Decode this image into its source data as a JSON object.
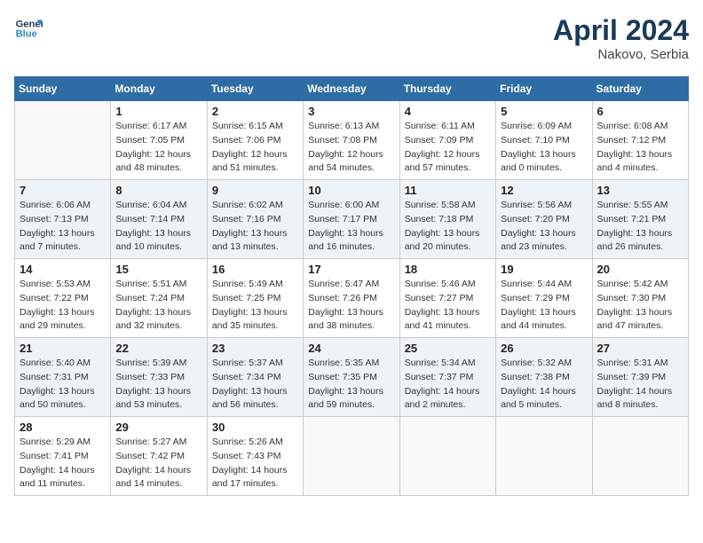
{
  "header": {
    "logo_line1": "General",
    "logo_line2": "Blue",
    "month_year": "April 2024",
    "location": "Nakovo, Serbia"
  },
  "columns": [
    "Sunday",
    "Monday",
    "Tuesday",
    "Wednesday",
    "Thursday",
    "Friday",
    "Saturday"
  ],
  "weeks": [
    [
      {
        "day": "",
        "info": ""
      },
      {
        "day": "1",
        "info": "Sunrise: 6:17 AM\nSunset: 7:05 PM\nDaylight: 12 hours\nand 48 minutes."
      },
      {
        "day": "2",
        "info": "Sunrise: 6:15 AM\nSunset: 7:06 PM\nDaylight: 12 hours\nand 51 minutes."
      },
      {
        "day": "3",
        "info": "Sunrise: 6:13 AM\nSunset: 7:08 PM\nDaylight: 12 hours\nand 54 minutes."
      },
      {
        "day": "4",
        "info": "Sunrise: 6:11 AM\nSunset: 7:09 PM\nDaylight: 12 hours\nand 57 minutes."
      },
      {
        "day": "5",
        "info": "Sunrise: 6:09 AM\nSunset: 7:10 PM\nDaylight: 13 hours\nand 0 minutes."
      },
      {
        "day": "6",
        "info": "Sunrise: 6:08 AM\nSunset: 7:12 PM\nDaylight: 13 hours\nand 4 minutes."
      }
    ],
    [
      {
        "day": "7",
        "info": "Sunrise: 6:06 AM\nSunset: 7:13 PM\nDaylight: 13 hours\nand 7 minutes."
      },
      {
        "day": "8",
        "info": "Sunrise: 6:04 AM\nSunset: 7:14 PM\nDaylight: 13 hours\nand 10 minutes."
      },
      {
        "day": "9",
        "info": "Sunrise: 6:02 AM\nSunset: 7:16 PM\nDaylight: 13 hours\nand 13 minutes."
      },
      {
        "day": "10",
        "info": "Sunrise: 6:00 AM\nSunset: 7:17 PM\nDaylight: 13 hours\nand 16 minutes."
      },
      {
        "day": "11",
        "info": "Sunrise: 5:58 AM\nSunset: 7:18 PM\nDaylight: 13 hours\nand 20 minutes."
      },
      {
        "day": "12",
        "info": "Sunrise: 5:56 AM\nSunset: 7:20 PM\nDaylight: 13 hours\nand 23 minutes."
      },
      {
        "day": "13",
        "info": "Sunrise: 5:55 AM\nSunset: 7:21 PM\nDaylight: 13 hours\nand 26 minutes."
      }
    ],
    [
      {
        "day": "14",
        "info": "Sunrise: 5:53 AM\nSunset: 7:22 PM\nDaylight: 13 hours\nand 29 minutes."
      },
      {
        "day": "15",
        "info": "Sunrise: 5:51 AM\nSunset: 7:24 PM\nDaylight: 13 hours\nand 32 minutes."
      },
      {
        "day": "16",
        "info": "Sunrise: 5:49 AM\nSunset: 7:25 PM\nDaylight: 13 hours\nand 35 minutes."
      },
      {
        "day": "17",
        "info": "Sunrise: 5:47 AM\nSunset: 7:26 PM\nDaylight: 13 hours\nand 38 minutes."
      },
      {
        "day": "18",
        "info": "Sunrise: 5:46 AM\nSunset: 7:27 PM\nDaylight: 13 hours\nand 41 minutes."
      },
      {
        "day": "19",
        "info": "Sunrise: 5:44 AM\nSunset: 7:29 PM\nDaylight: 13 hours\nand 44 minutes."
      },
      {
        "day": "20",
        "info": "Sunrise: 5:42 AM\nSunset: 7:30 PM\nDaylight: 13 hours\nand 47 minutes."
      }
    ],
    [
      {
        "day": "21",
        "info": "Sunrise: 5:40 AM\nSunset: 7:31 PM\nDaylight: 13 hours\nand 50 minutes."
      },
      {
        "day": "22",
        "info": "Sunrise: 5:39 AM\nSunset: 7:33 PM\nDaylight: 13 hours\nand 53 minutes."
      },
      {
        "day": "23",
        "info": "Sunrise: 5:37 AM\nSunset: 7:34 PM\nDaylight: 13 hours\nand 56 minutes."
      },
      {
        "day": "24",
        "info": "Sunrise: 5:35 AM\nSunset: 7:35 PM\nDaylight: 13 hours\nand 59 minutes."
      },
      {
        "day": "25",
        "info": "Sunrise: 5:34 AM\nSunset: 7:37 PM\nDaylight: 14 hours\nand 2 minutes."
      },
      {
        "day": "26",
        "info": "Sunrise: 5:32 AM\nSunset: 7:38 PM\nDaylight: 14 hours\nand 5 minutes."
      },
      {
        "day": "27",
        "info": "Sunrise: 5:31 AM\nSunset: 7:39 PM\nDaylight: 14 hours\nand 8 minutes."
      }
    ],
    [
      {
        "day": "28",
        "info": "Sunrise: 5:29 AM\nSunset: 7:41 PM\nDaylight: 14 hours\nand 11 minutes."
      },
      {
        "day": "29",
        "info": "Sunrise: 5:27 AM\nSunset: 7:42 PM\nDaylight: 14 hours\nand 14 minutes."
      },
      {
        "day": "30",
        "info": "Sunrise: 5:26 AM\nSunset: 7:43 PM\nDaylight: 14 hours\nand 17 minutes."
      },
      {
        "day": "",
        "info": ""
      },
      {
        "day": "",
        "info": ""
      },
      {
        "day": "",
        "info": ""
      },
      {
        "day": "",
        "info": ""
      }
    ]
  ]
}
